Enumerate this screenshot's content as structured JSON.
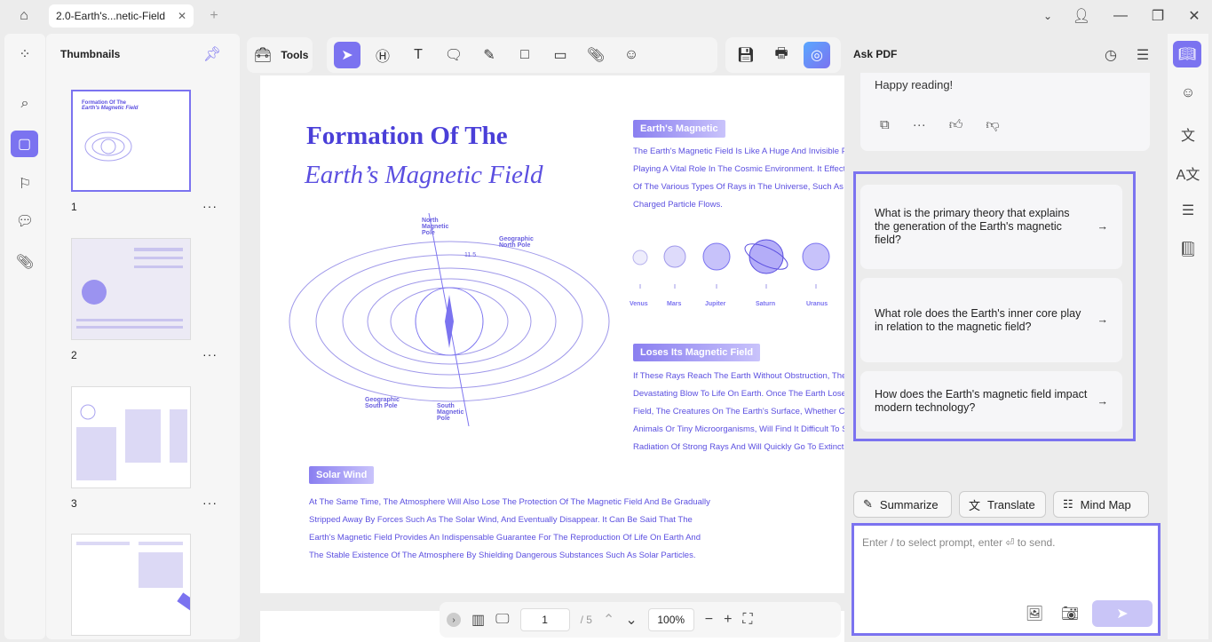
{
  "tabs": {
    "active": "2.0-Earth's...netic-Field",
    "close": "✕",
    "add": "+"
  },
  "sidebar": {
    "title": "Thumbnails",
    "pages": [
      "1",
      "2",
      "3"
    ],
    "more": "···"
  },
  "toolbar": {
    "tools_label": "Tools"
  },
  "page": {
    "title1": "Formation Of The",
    "title2": "Earth’s Magnetic Field",
    "sec1": "Earth's Magnetic",
    "sec1_lines": [
      "The Earth's Magnetic Field Is Like A Huge And Invisible P",
      "Playing A Vital Role In The Cosmic Environment. It Effect",
      "Of The Various Types Of Rays in The Universe, Such As",
      "Charged Particle Flows."
    ],
    "planets": [
      "Venus",
      "Mars",
      "Jupiter",
      "Saturn",
      "Uranus"
    ],
    "diagram": {
      "north_mag": "North Magnetic Pole",
      "geo_north": "Geographic North Pole",
      "geo_south": "Geographic South Pole",
      "south_mag": "South Magnetic Pole",
      "angle": "11.5"
    },
    "sec2": "Loses Its Magnetic Field",
    "sec2_lines": [
      "If These Rays Reach The Earth Without Obstruction, The",
      "Devastating Blow To Life On Earth. Once The Earth Lose",
      "Field, The Creatures On The Earth's Surface, Whether Co",
      "Animals Or Tiny Microorganisms, Will Find It Difficult To S",
      "Radiation Of Strong Rays And Will Quickly Go To Extincti"
    ],
    "sec3": "Solar Wind",
    "sec3_lines": [
      "At The Same Time, The Atmosphere Will Also Lose The Protection Of The Magnetic Field And Be Gradually",
      "Stripped Away By Forces Such As The Solar Wind, And Eventually Disappear. It Can Be Said That The",
      "Earth's Magnetic Field Provides An Indispensable Guarantee For The Reproduction Of Life On Earth And",
      "The Stable Existence Of The Atmosphere By Shielding Dangerous Substances Such As Solar Particles."
    ]
  },
  "nav": {
    "page": "1",
    "total": "/ 5",
    "zoom": "100%"
  },
  "ask": {
    "title": "Ask PDF",
    "prev_message": "Happy reading!",
    "suggestions": [
      "What is the primary theory that explains the generation of the Earth's magnetic field?",
      "What role does the Earth's inner core play in relation to the magnetic field?",
      "How does the Earth's magnetic field impact modern technology?"
    ],
    "chips": [
      "Summarize",
      "Translate",
      "Mind Map"
    ],
    "placeholder": "Enter / to select prompt, enter ⏎ to send."
  },
  "colors": {
    "accent": "#7b73f0",
    "text_purple": "#5b4fe0"
  }
}
